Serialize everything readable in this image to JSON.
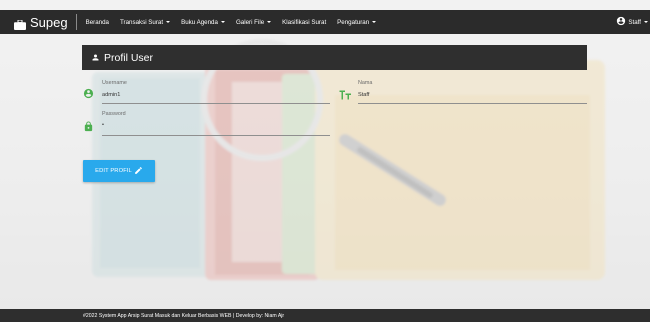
{
  "navbar": {
    "brand": "Supeg",
    "items": [
      {
        "label": "Beranda",
        "dropdown": false
      },
      {
        "label": "Transaksi Surat",
        "dropdown": true
      },
      {
        "label": "Buku Agenda",
        "dropdown": true
      },
      {
        "label": "Galeri File",
        "dropdown": true
      },
      {
        "label": "Klasifikasi Surat",
        "dropdown": false
      },
      {
        "label": "Pengaturan",
        "dropdown": true
      }
    ],
    "user": "Staff"
  },
  "card": {
    "title": "Profil User"
  },
  "form": {
    "username_label": "Username",
    "username_value": "admin1",
    "password_label": "Password",
    "password_value": "•",
    "nama_label": "Nama",
    "nama_value": "Staff"
  },
  "button": {
    "edit_label": "EDIT PROFIL"
  },
  "footer": {
    "text": "#2022 System App Arsip Surat Masuk dan Keluar Berbasis WEB | Develop by: Niam Ajr"
  },
  "colors": {
    "navbar": "#2b2b2b",
    "card_header": "#2f2f2f",
    "field_icon": "#4caf50",
    "button": "#29a9ec",
    "footer": "#2e2e2e"
  },
  "icons": {
    "brand": "briefcase-icon",
    "user": "account-circle-icon",
    "card_title": "person-icon",
    "username": "account-circle-icon",
    "password": "lock-icon",
    "nama": "text-format-icon",
    "edit": "pencil-icon"
  }
}
